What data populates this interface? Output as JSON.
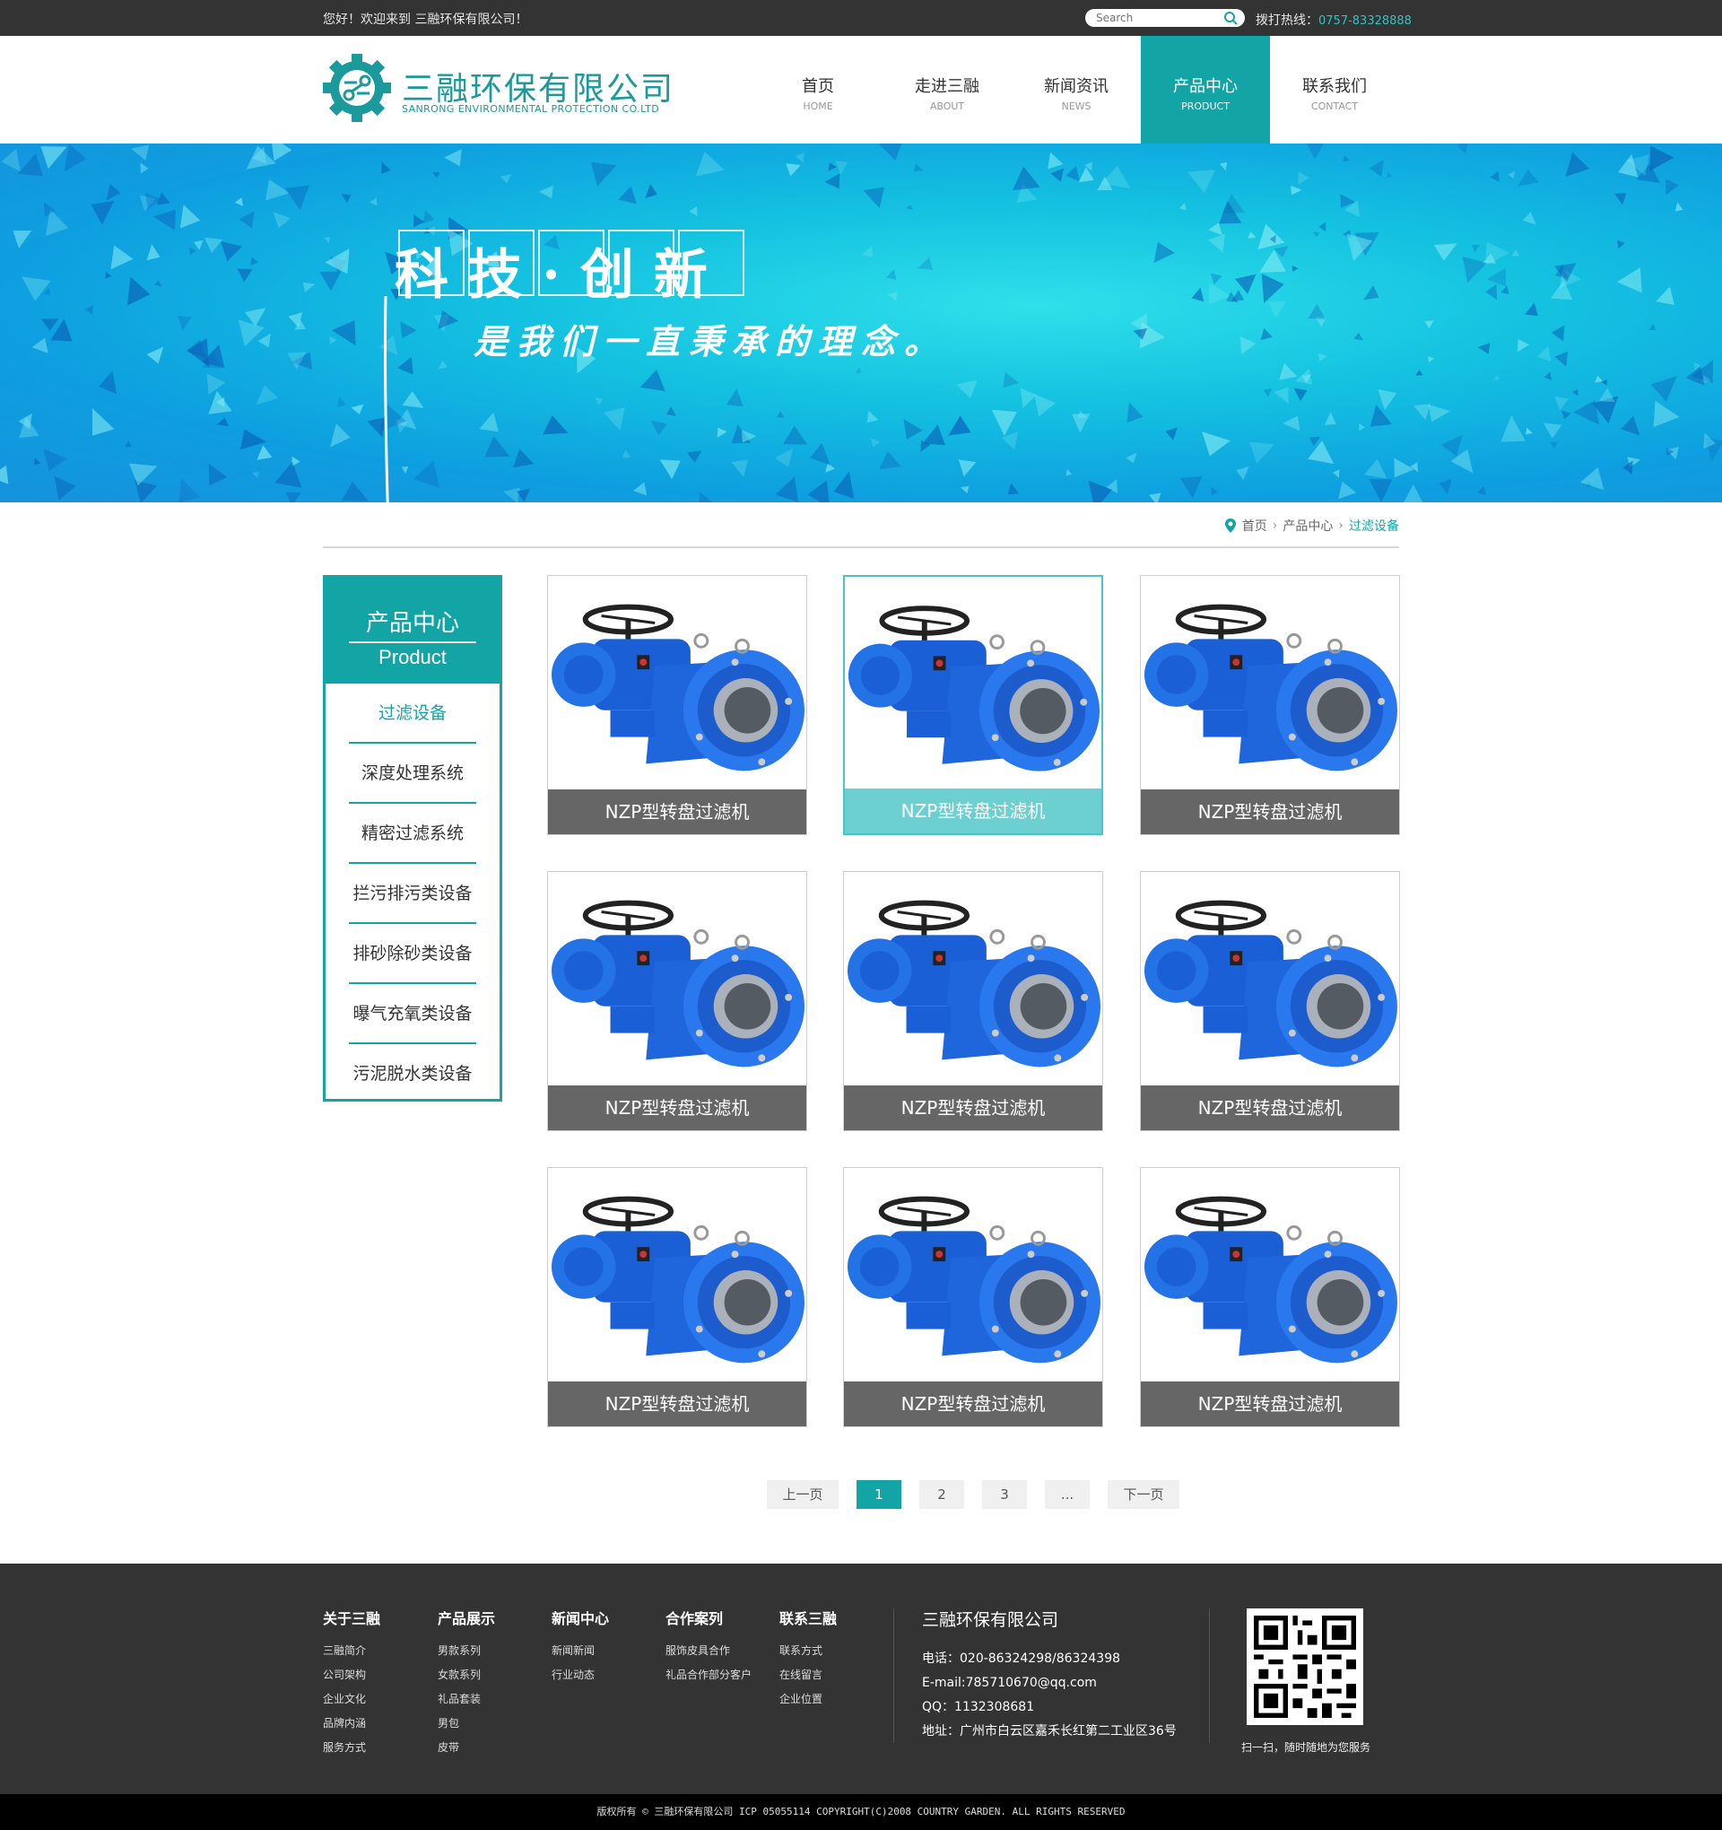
{
  "topbar": {
    "welcome": "您好！欢迎来到 三融环保有限公司！",
    "search_placeholder": "Search",
    "hotline_label": "拨打热线：",
    "hotline_number": "0757-83328888"
  },
  "header": {
    "brand_cn": "三融环保有限公司",
    "brand_en": "SANRONG ENVIRONMENTAL PROTECTION CO.LTD",
    "nav": [
      {
        "cn": "首页",
        "en": "HOME"
      },
      {
        "cn": "走进三融",
        "en": "ABOUT"
      },
      {
        "cn": "新闻资讯",
        "en": "NEWS"
      },
      {
        "cn": "产品中心",
        "en": "PRODUCT"
      },
      {
        "cn": "联系我们",
        "en": "CONTACT"
      }
    ],
    "active_nav": "PRODUCT"
  },
  "banner": {
    "title": "科技·创新",
    "subtitle": "是我们一直秉承的理念。"
  },
  "breadcrumb": {
    "home": "首页",
    "section": "产品中心",
    "current": "过滤设备"
  },
  "sidebar": {
    "title_cn": "产品中心",
    "title_en": "Product",
    "items": [
      "过滤设备",
      "深度处理系统",
      "精密过滤系统",
      "拦污排污类设备",
      "排砂除砂类设备",
      "曝气充氧类设备",
      "污泥脱水类设备"
    ],
    "active": "过滤设备"
  },
  "products": [
    {
      "name": "NZP型转盘过滤机"
    },
    {
      "name": "NZP型转盘过滤机"
    },
    {
      "name": "NZP型转盘过滤机"
    },
    {
      "name": "NZP型转盘过滤机"
    },
    {
      "name": "NZP型转盘过滤机"
    },
    {
      "name": "NZP型转盘过滤机"
    },
    {
      "name": "NZP型转盘过滤机"
    },
    {
      "name": "NZP型转盘过滤机"
    },
    {
      "name": "NZP型转盘过滤机"
    }
  ],
  "pagination": {
    "prev": "上一页",
    "pages": [
      "1",
      "2",
      "3",
      "..."
    ],
    "current": "1",
    "next": "下一页"
  },
  "footer": {
    "columns": [
      {
        "title": "关于三融",
        "links": [
          "三融简介",
          "公司架构",
          "企业文化",
          "品牌内涵",
          "服务方式"
        ]
      },
      {
        "title": "产品展示",
        "links": [
          "男款系列",
          "女款系列",
          "礼品套装",
          "男包",
          "皮带"
        ]
      },
      {
        "title": "新闻中心",
        "links": [
          "新闻新闻",
          "行业动态"
        ]
      },
      {
        "title": "合作案列",
        "links": [
          "服饰皮具合作",
          "礼品合作部分客户"
        ]
      },
      {
        "title": "联系三融",
        "links": [
          "联系方式",
          "在线留言",
          "企业位置"
        ]
      }
    ],
    "company": "三融环保有限公司",
    "phone": "电话：020-86324298/86324398",
    "email": "E-mail:785710670@qq.com",
    "qq": "QQ：1132308681",
    "address": "地址：广州市白云区嘉禾长红第二工业区36号",
    "qr_caption": "扫一扫，随时随地为您服务",
    "copyright": "版权所有 © 三融环保有限公司 ICP 05055114 COPYRIGHT(C)2008 COUNTRY GARDEN. ALL RIGHTS RESERVED"
  },
  "colors": {
    "accent": "#13a5a5",
    "topbar": "#333333",
    "caption": "#666666",
    "caption_hover": "#6ccfd0"
  }
}
